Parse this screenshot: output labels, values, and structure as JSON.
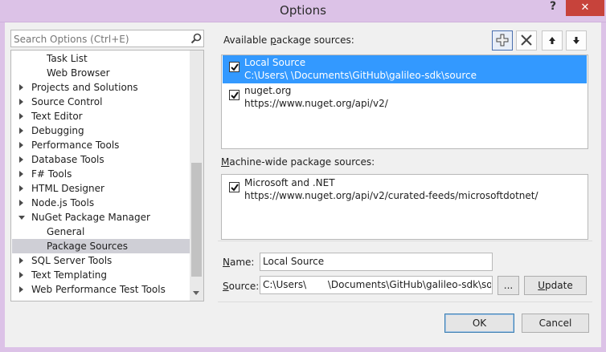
{
  "window": {
    "title": "Options",
    "help_glyph": "?",
    "close_glyph": "✕"
  },
  "search": {
    "placeholder": "Search Options (Ctrl+E)",
    "icon": "search-icon"
  },
  "tree": {
    "items": [
      {
        "label": "Task List",
        "level": 1,
        "arrow": "none",
        "selected": false
      },
      {
        "label": "Web Browser",
        "level": 1,
        "arrow": "none",
        "selected": false
      },
      {
        "label": "Projects and Solutions",
        "level": 0,
        "arrow": "collapsed",
        "selected": false
      },
      {
        "label": "Source Control",
        "level": 0,
        "arrow": "collapsed",
        "selected": false
      },
      {
        "label": "Text Editor",
        "level": 0,
        "arrow": "collapsed",
        "selected": false
      },
      {
        "label": "Debugging",
        "level": 0,
        "arrow": "collapsed",
        "selected": false
      },
      {
        "label": "Performance Tools",
        "level": 0,
        "arrow": "collapsed",
        "selected": false
      },
      {
        "label": "Database Tools",
        "level": 0,
        "arrow": "collapsed",
        "selected": false
      },
      {
        "label": "F# Tools",
        "level": 0,
        "arrow": "collapsed",
        "selected": false
      },
      {
        "label": "HTML Designer",
        "level": 0,
        "arrow": "collapsed",
        "selected": false
      },
      {
        "label": "Node.js Tools",
        "level": 0,
        "arrow": "collapsed",
        "selected": false
      },
      {
        "label": "NuGet Package Manager",
        "level": 0,
        "arrow": "expanded",
        "selected": false
      },
      {
        "label": "General",
        "level": 1,
        "arrow": "none",
        "selected": false
      },
      {
        "label": "Package Sources",
        "level": 1,
        "arrow": "none",
        "selected": true
      },
      {
        "label": "SQL Server Tools",
        "level": 0,
        "arrow": "collapsed",
        "selected": false
      },
      {
        "label": "Text Templating",
        "level": 0,
        "arrow": "collapsed",
        "selected": false
      },
      {
        "label": "Web Performance Test Tools",
        "level": 0,
        "arrow": "collapsed",
        "selected": false
      }
    ]
  },
  "available": {
    "label_prefix": "Available ",
    "label_accel": "p",
    "label_suffix": "ackage sources:",
    "toolbar": [
      {
        "name": "add-source-button",
        "icon": "plus-icon"
      },
      {
        "name": "remove-source-button",
        "icon": "x-icon"
      },
      {
        "name": "move-up-button",
        "icon": "arrow-up-icon"
      },
      {
        "name": "move-down-button",
        "icon": "arrow-down-icon"
      }
    ],
    "sources": [
      {
        "name": "Local Source",
        "url": "C:\\Users\\      \\Documents\\GitHub\\galileo-sdk\\source",
        "checked": true,
        "selected": true
      },
      {
        "name": "nuget.org",
        "url": "https://www.nuget.org/api/v2/",
        "checked": true,
        "selected": false
      }
    ]
  },
  "machine_wide": {
    "label_accel": "M",
    "label_suffix": "achine-wide package sources:",
    "sources": [
      {
        "name": "Microsoft and .NET",
        "url": "https://www.nuget.org/api/v2/curated-feeds/microsoftdotnet/",
        "checked": true
      }
    ]
  },
  "form": {
    "name_label_accel": "N",
    "name_label_suffix": "ame:",
    "name_value": "Local Source",
    "source_label_accel": "S",
    "source_label_suffix": "ource:",
    "source_value": "C:\\Users\\       \\Documents\\GitHub\\galileo-sdk\\sou",
    "browse_label": "...",
    "update_label_accel": "U",
    "update_label_suffix": "pdate"
  },
  "footer": {
    "ok_label": "OK",
    "cancel_label": "Cancel"
  },
  "colors": {
    "titlebar": "#dcc2e7",
    "close": "#c7433b",
    "selection": "#3399ff",
    "tree_selection": "#cfcfd6"
  }
}
